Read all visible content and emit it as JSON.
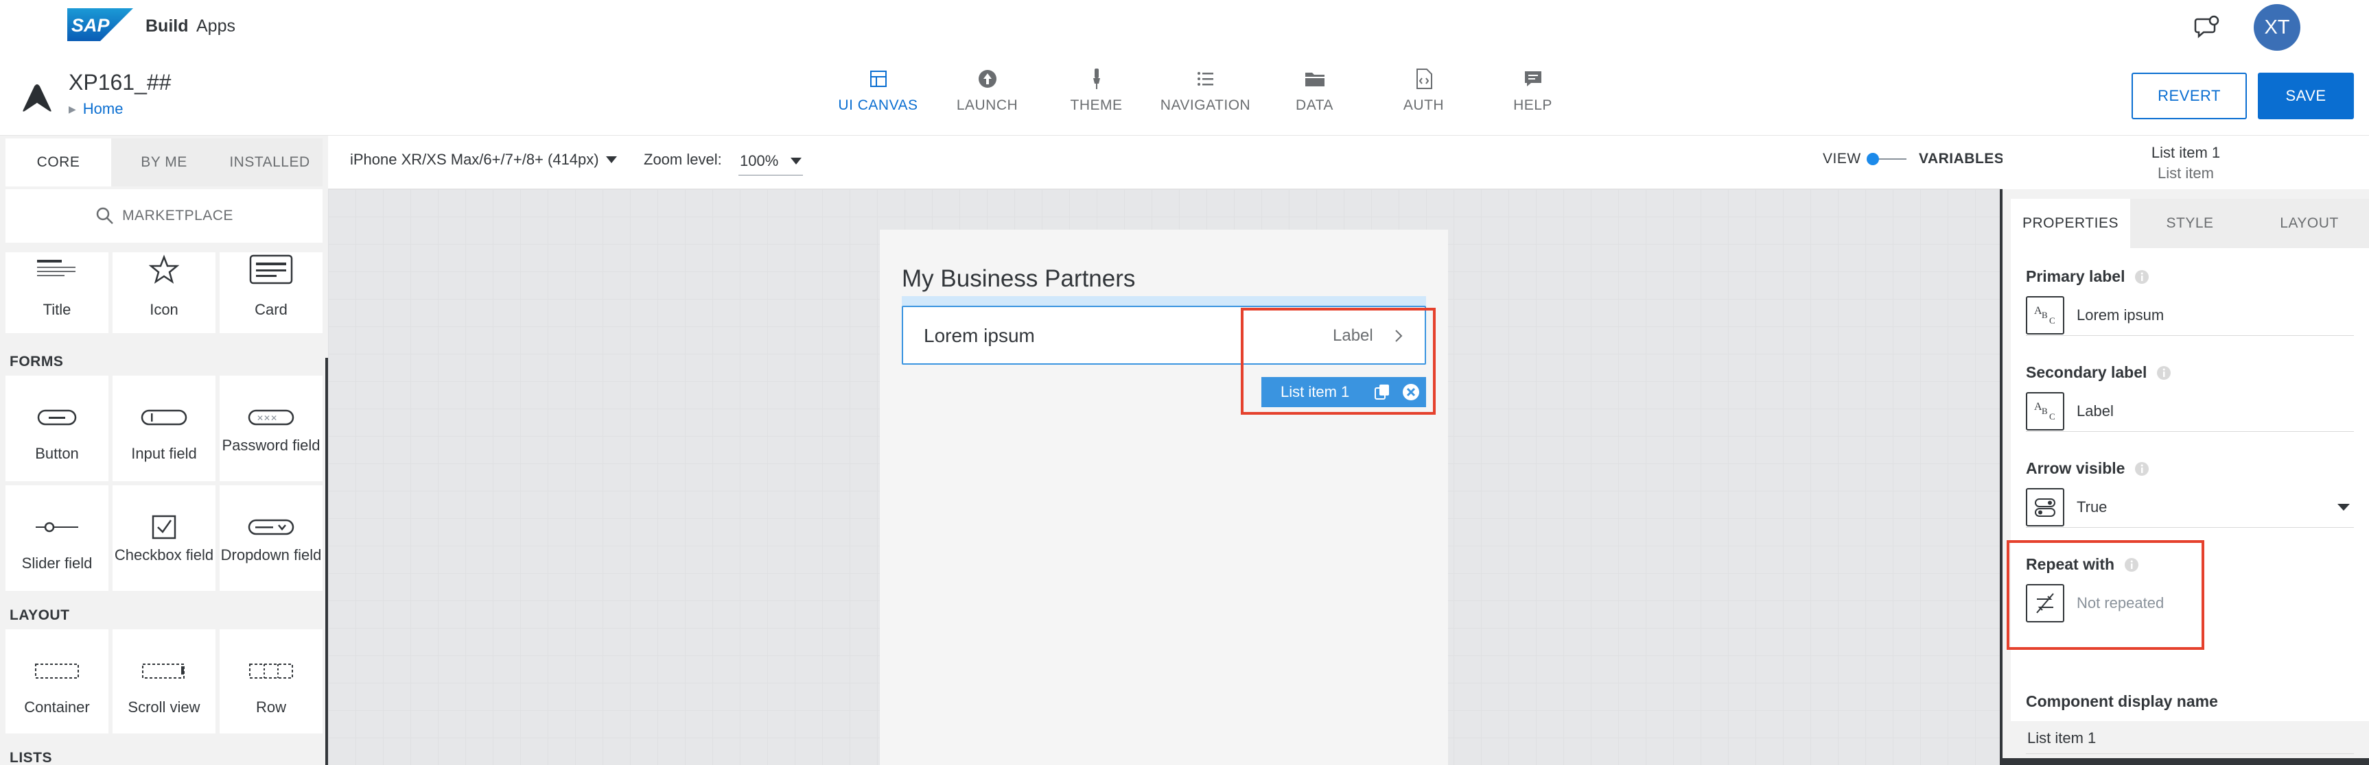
{
  "topbar": {
    "brand_logo": "SAP",
    "brand_build": "Build",
    "brand_apps": "Apps",
    "notification_icon": "chat-notification-icon",
    "avatar_initials": "XT",
    "avatar_color": "#3b6fb6"
  },
  "header": {
    "project_name": "XP161_##",
    "breadcrumb_home": "Home",
    "nav": [
      {
        "label": "UI CANVAS",
        "icon": "ui-canvas-icon",
        "active": true
      },
      {
        "label": "LAUNCH",
        "icon": "launch-icon",
        "active": false
      },
      {
        "label": "THEME",
        "icon": "theme-brush-icon",
        "active": false
      },
      {
        "label": "NAVIGATION",
        "icon": "navigation-list-icon",
        "active": false
      },
      {
        "label": "DATA",
        "icon": "folder-icon",
        "active": false
      },
      {
        "label": "AUTH",
        "icon": "auth-file-icon",
        "active": false
      },
      {
        "label": "HELP",
        "icon": "help-chat-icon",
        "active": false
      }
    ],
    "revert_label": "REVERT",
    "save_label": "SAVE",
    "accent_color": "#0a6ed1"
  },
  "left_panel": {
    "tabs": [
      {
        "label": "CORE",
        "active": true
      },
      {
        "label": "BY ME",
        "active": false
      },
      {
        "label": "INSTALLED",
        "active": false
      }
    ],
    "marketplace_label": "MARKETPLACE",
    "core_tiles": [
      {
        "label": "Title",
        "icon": "title-icon"
      },
      {
        "label": "Icon",
        "icon": "star-icon"
      },
      {
        "label": "Card",
        "icon": "card-icon"
      }
    ],
    "forms_label": "FORMS",
    "forms_tiles": [
      {
        "label": "Button",
        "icon": "button-icon"
      },
      {
        "label": "Input field",
        "icon": "input-field-icon"
      },
      {
        "label": "Password field",
        "icon": "password-field-icon"
      },
      {
        "label": "Slider field",
        "icon": "slider-icon"
      },
      {
        "label": "Checkbox field",
        "icon": "checkbox-icon"
      },
      {
        "label": "Dropdown field",
        "icon": "dropdown-icon"
      }
    ],
    "layout_label": "LAYOUT",
    "layout_tiles": [
      {
        "label": "Container",
        "icon": "container-icon"
      },
      {
        "label": "Scroll view",
        "icon": "scroll-view-icon"
      },
      {
        "label": "Row",
        "icon": "row-icon"
      }
    ],
    "lists_label": "LISTS"
  },
  "canvas_toolbar": {
    "device": "iPhone XR/XS Max/6+/7+/8+ (414px)",
    "zoom_label": "Zoom level:",
    "zoom_value": "100%",
    "view_label": "VIEW",
    "variables_label": "VARIABLES",
    "toggle_state": "view"
  },
  "canvas": {
    "page_title": "My Business Partners",
    "list_item": {
      "primary": "Lorem ipsum",
      "secondary": "Label",
      "arrow_icon": "chevron-right-icon"
    },
    "selection_tag": {
      "label": "List item 1",
      "copy_icon": "copy-icon",
      "remove_icon": "close-circle-icon"
    },
    "highlight_color": "#e5412d"
  },
  "right_panel": {
    "selected_title": "List item 1",
    "selected_type": "List item",
    "tabs": [
      {
        "label": "PROPERTIES",
        "active": true
      },
      {
        "label": "STYLE",
        "active": false
      },
      {
        "label": "LAYOUT",
        "active": false
      }
    ],
    "primary_label": {
      "label": "Primary label",
      "value": "Lorem ipsum"
    },
    "secondary_label": {
      "label": "Secondary label",
      "value": "Label"
    },
    "arrow_visible": {
      "label": "Arrow visible",
      "value": "True"
    },
    "repeat_with": {
      "label": "Repeat with",
      "value": "Not repeated"
    },
    "component_display_name": {
      "label": "Component display name",
      "value": "List item 1"
    }
  }
}
